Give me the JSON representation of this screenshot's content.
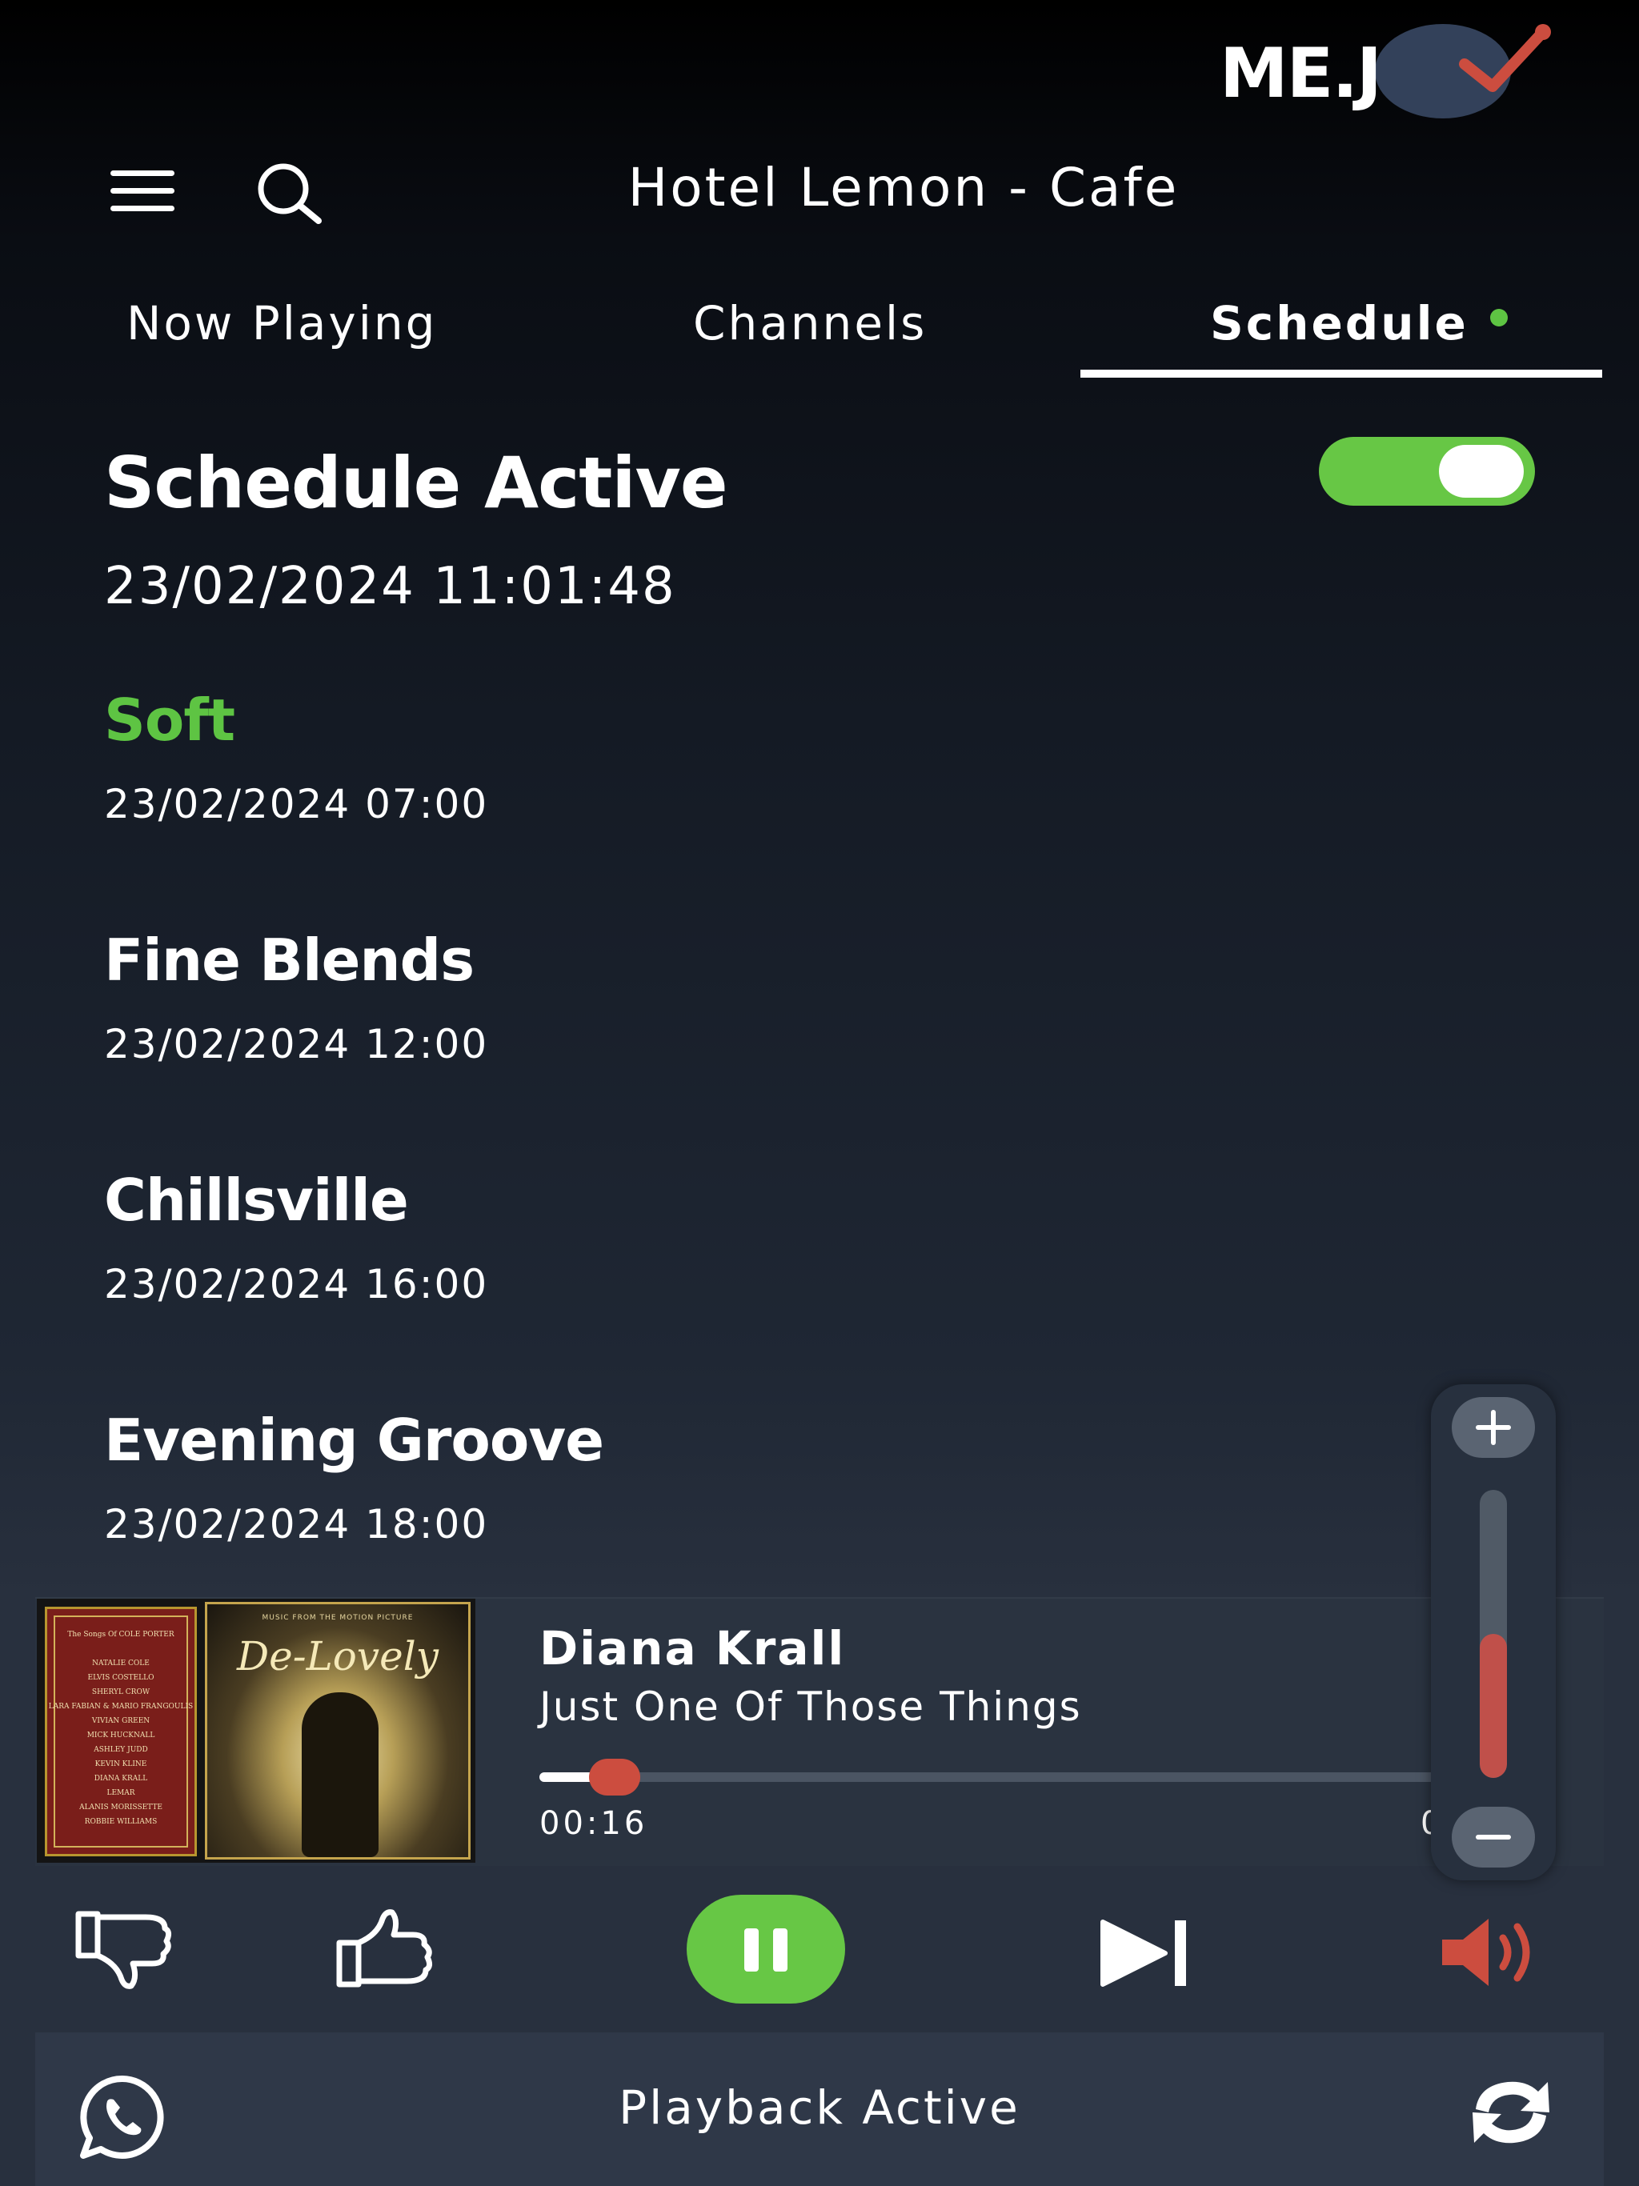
{
  "logo": {
    "text": "ME.J"
  },
  "header": {
    "title": "Hotel Lemon - Cafe"
  },
  "tabs": [
    {
      "label": "Now Playing"
    },
    {
      "label": "Channels"
    },
    {
      "label": "Schedule",
      "active": true,
      "indicator_color": "#5ec443"
    }
  ],
  "schedule": {
    "title": "Schedule Active",
    "datetime": "23/02/2024 11:01:48",
    "enabled": true,
    "toggle_color": "#67c745",
    "items": [
      {
        "name": "Soft",
        "time": "23/02/2024 07:00",
        "active": true
      },
      {
        "name": "Fine Blends",
        "time": "23/02/2024 12:00"
      },
      {
        "name": "Chillsville",
        "time": "23/02/2024 16:00"
      },
      {
        "name": "Evening Groove",
        "time": "23/02/2024 18:00"
      }
    ]
  },
  "now_playing": {
    "album_title": "De-Lovely",
    "album_subtitle": "MUSIC FROM THE MOTION PICTURE",
    "album_back_header": "The Songs Of COLE PORTER",
    "album_back_performers": [
      "NATALIE COLE",
      "ELVIS COSTELLO",
      "SHERYL CROW",
      "LARA FABIAN & MARIO FRANGOULIS",
      "VIVIAN GREEN",
      "MICK HUCKNALL",
      "ASHLEY JUDD",
      "KEVIN KLINE",
      "DIANA KRALL",
      "LEMAR",
      "ALANIS MORISSETTE",
      "ROBBIE WILLIAMS"
    ],
    "artist": "Diana Krall",
    "track": "Just One Of Those Things",
    "elapsed": "00:16",
    "duration_partial": "0",
    "progress": 0.05
  },
  "volume": {
    "level": 0.5,
    "fill_color": "#c0504a"
  },
  "controls": {
    "thumbs_down_icon": "thumbs-down-icon",
    "thumbs_up_icon": "thumbs-up-icon",
    "pause_icon": "pause-icon",
    "skip_icon": "skip-next-icon",
    "volume_icon": "volume-icon",
    "accent_color": "#67c745",
    "volume_icon_color": "#cc4d3f"
  },
  "status_bar": {
    "text": "Playback Active"
  }
}
